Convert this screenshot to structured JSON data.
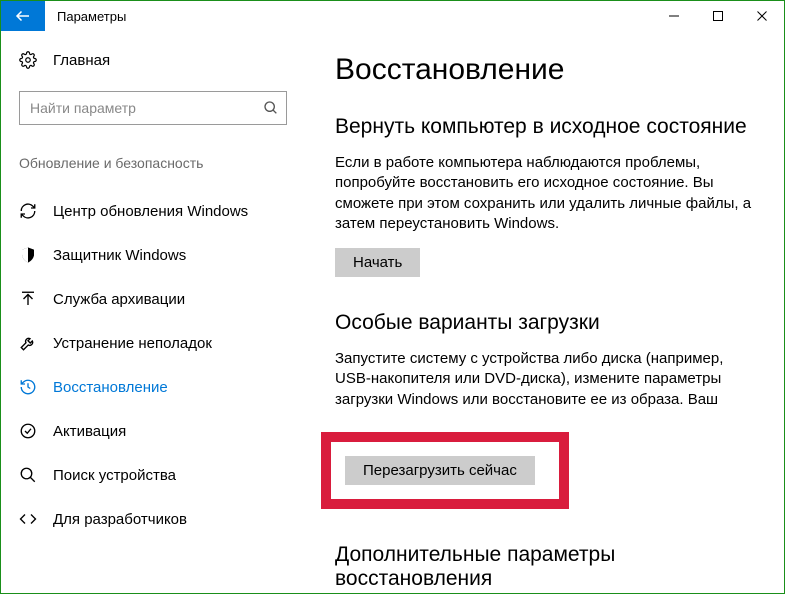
{
  "titlebar": {
    "label": "Параметры"
  },
  "sidebar": {
    "home_label": "Главная",
    "search_placeholder": "Найти параметр",
    "section_label": "Обновление и безопасность",
    "items": [
      {
        "label": "Центр обновления Windows"
      },
      {
        "label": "Защитник Windows"
      },
      {
        "label": "Служба архивации"
      },
      {
        "label": "Устранение неполадок"
      },
      {
        "label": "Восстановление"
      },
      {
        "label": "Активация"
      },
      {
        "label": "Поиск устройства"
      },
      {
        "label": "Для разработчиков"
      }
    ]
  },
  "content": {
    "title": "Восстановление",
    "reset": {
      "heading": "Вернуть компьютер в исходное состояние",
      "body": "Если в работе компьютера наблюдаются проблемы, попробуйте восстановить его исходное состояние. Вы сможете при этом сохранить или удалить личные файлы, а затем переустановить Windows.",
      "button": "Начать"
    },
    "advanced": {
      "heading": "Особые варианты загрузки",
      "body": "Запустите систему с устройства либо диска (например, USB-накопителя или DVD-диска), измените параметры загрузки Windows или восстановите ее из образа. Ваш",
      "button": "Перезагрузить сейчас"
    },
    "more": {
      "heading": "Дополнительные параметры восстановления"
    }
  }
}
